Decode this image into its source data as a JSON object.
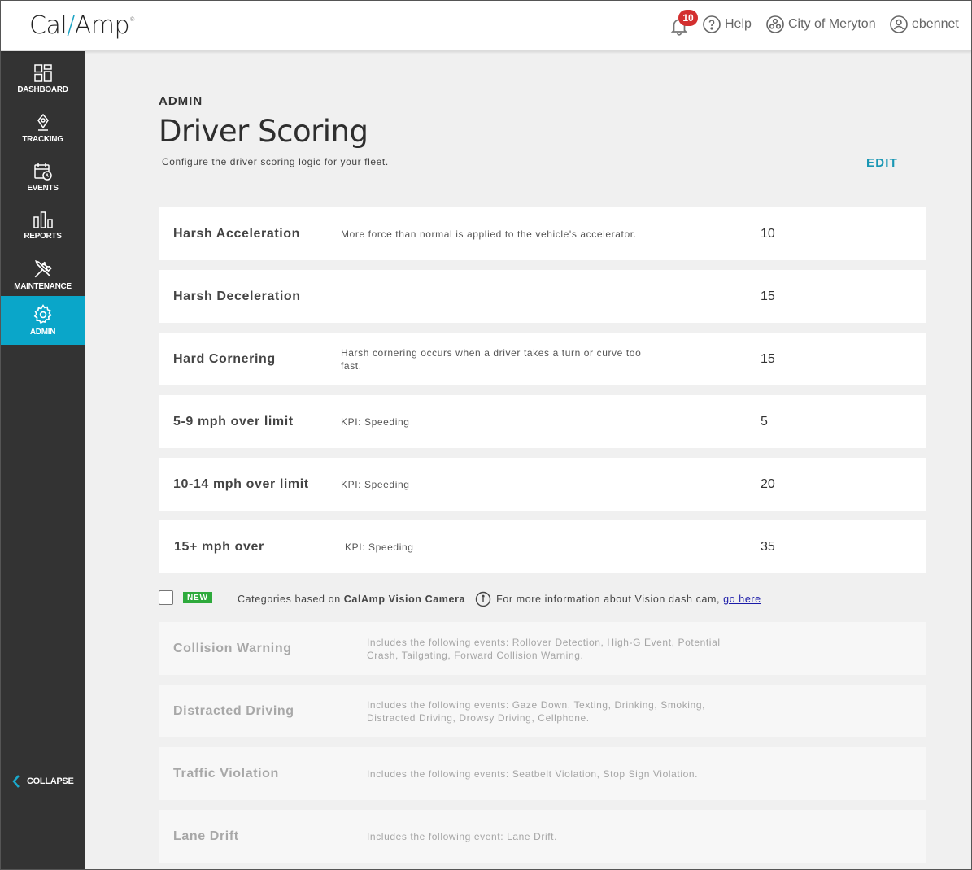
{
  "header": {
    "logo_left": "Cal",
    "logo_slash": "/",
    "logo_right": "Amp",
    "logo_mark": "®",
    "notifications_count": "10",
    "help_label": "Help",
    "org_label": "City of Meryton",
    "user_label": "ebennet"
  },
  "sidebar": {
    "items": [
      {
        "label": "DASHBOARD",
        "icon": "dashboard-icon"
      },
      {
        "label": "TRACKING",
        "icon": "map-pin-icon"
      },
      {
        "label": "EVENTS",
        "icon": "calendar-clock-icon"
      },
      {
        "label": "REPORTS",
        "icon": "bar-chart-icon"
      },
      {
        "label": "MAINTENANCE",
        "icon": "tools-icon"
      },
      {
        "label": "ADMIN",
        "icon": "gear-icon",
        "active": true
      }
    ],
    "collapse_label": "COLLAPSE"
  },
  "page": {
    "eyebrow": "ADMIN",
    "title": "Driver Scoring",
    "subtitle": "Configure the driver scoring logic for your fleet.",
    "edit_label": "EDIT"
  },
  "rules": [
    {
      "name": "Harsh Acceleration",
      "desc": "More force than normal is applied to the vehicle's accelerator.",
      "value": "10"
    },
    {
      "name": "Harsh Deceleration",
      "desc": "",
      "value": "15"
    },
    {
      "name": "Hard Cornering",
      "desc": "Harsh cornering occurs when a driver takes a turn or curve too fast.",
      "value": "15"
    },
    {
      "name": "5-9 mph over limit",
      "desc": "KPI: Speeding",
      "value": "5"
    },
    {
      "name": "10-14 mph over limit",
      "desc": "KPI: Speeding",
      "value": "20"
    },
    {
      "name": "15+ mph over",
      "desc": "KPI: Speeding",
      "value": "35"
    }
  ],
  "vision": {
    "new_tag": "NEW",
    "text_before": "Categories based on",
    "brand": "CalAmp Vision Camera",
    "info_text": "For more information about Vision dash cam,",
    "link_text": "go here"
  },
  "vision_rules": [
    {
      "name": "Collision Warning",
      "desc": "Includes the following events: Rollover Detection, High-G Event, Potential Crash, Tailgating, Forward Collision Warning."
    },
    {
      "name": "Distracted Driving",
      "desc": "Includes the following events: Gaze Down, Texting, Drinking, Smoking, Distracted Driving, Drowsy Driving, Cellphone."
    },
    {
      "name": "Traffic Violation",
      "desc": "Includes the following events: Seatbelt Violation, Stop Sign Violation."
    },
    {
      "name": "Lane Drift",
      "desc": "Includes the following event: Lane Drift."
    }
  ],
  "colors": {
    "accent": "#0aa6c9",
    "sidebar": "#333333",
    "new_tag": "#2eaa3c",
    "badge": "#d32f2f"
  }
}
